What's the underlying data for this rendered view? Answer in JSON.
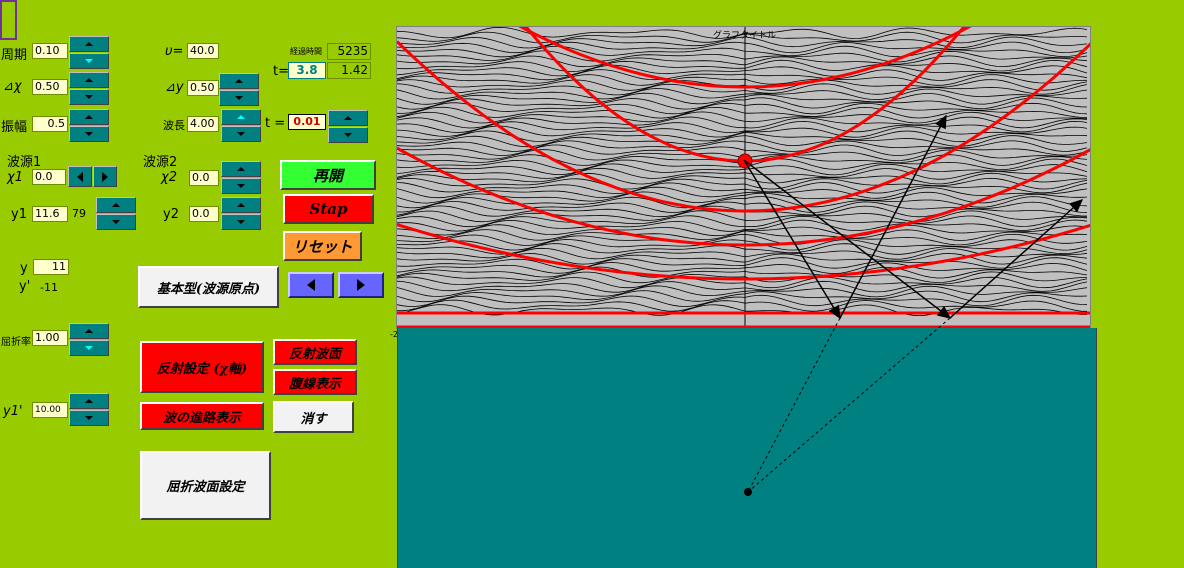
{
  "params": {
    "period_label": "周期",
    "period_value": "0.10",
    "dx_label": "⊿χ",
    "dx_value": "0.50",
    "amp_label": "振幅",
    "amp_value": "0.5",
    "v_label": "υ=",
    "v_value": "40.0",
    "dy_label": "⊿y",
    "dy_value": "0.50",
    "wavelength_label": "波長",
    "wavelength_value": "4.00"
  },
  "time": {
    "elapsed_label": "経過時間",
    "elapsed_value": "5235",
    "t_label": "t=",
    "t_value": "3.8",
    "t_sub": "1.42",
    "t2_label": "t =",
    "t2_value": "0.01"
  },
  "source1": {
    "title": "波源1",
    "x_label": "χ1",
    "x_value": "0.0",
    "y_label": "y1",
    "y_value": "11.6",
    "y_extra": "79"
  },
  "source2": {
    "title": "波源2",
    "x_label": "χ2",
    "x_value": "0.0",
    "y_label": "y2",
    "y_value": "0.0"
  },
  "ycoord": {
    "y_label": "y",
    "y_value": "11",
    "yprime_label": "y'",
    "yprime_value": "-11"
  },
  "refraction": {
    "n_label": "屈折率",
    "n_value": "1.00",
    "y1p_label": "y1'",
    "y1p_value": "10.00"
  },
  "buttons": {
    "resume": "再開",
    "stop": "Stap",
    "reset": "リセット",
    "basic": "基本型(波源原点)",
    "reflection_setup": "反射設定 (χ軸)",
    "reflected_wavefront": "反射波面",
    "antinode_display": "腹線表示",
    "wave_path": "波の進路表示",
    "erase": "消す",
    "refraction_setup": "屈折波面設定"
  },
  "graph": {
    "title": "グラフタイトル",
    "axis_tick": "-2"
  },
  "colors": {
    "background": "#99cc00",
    "teal": "#008080",
    "graph_bg": "#c0c0c0",
    "wavefront": "#ff0000"
  }
}
